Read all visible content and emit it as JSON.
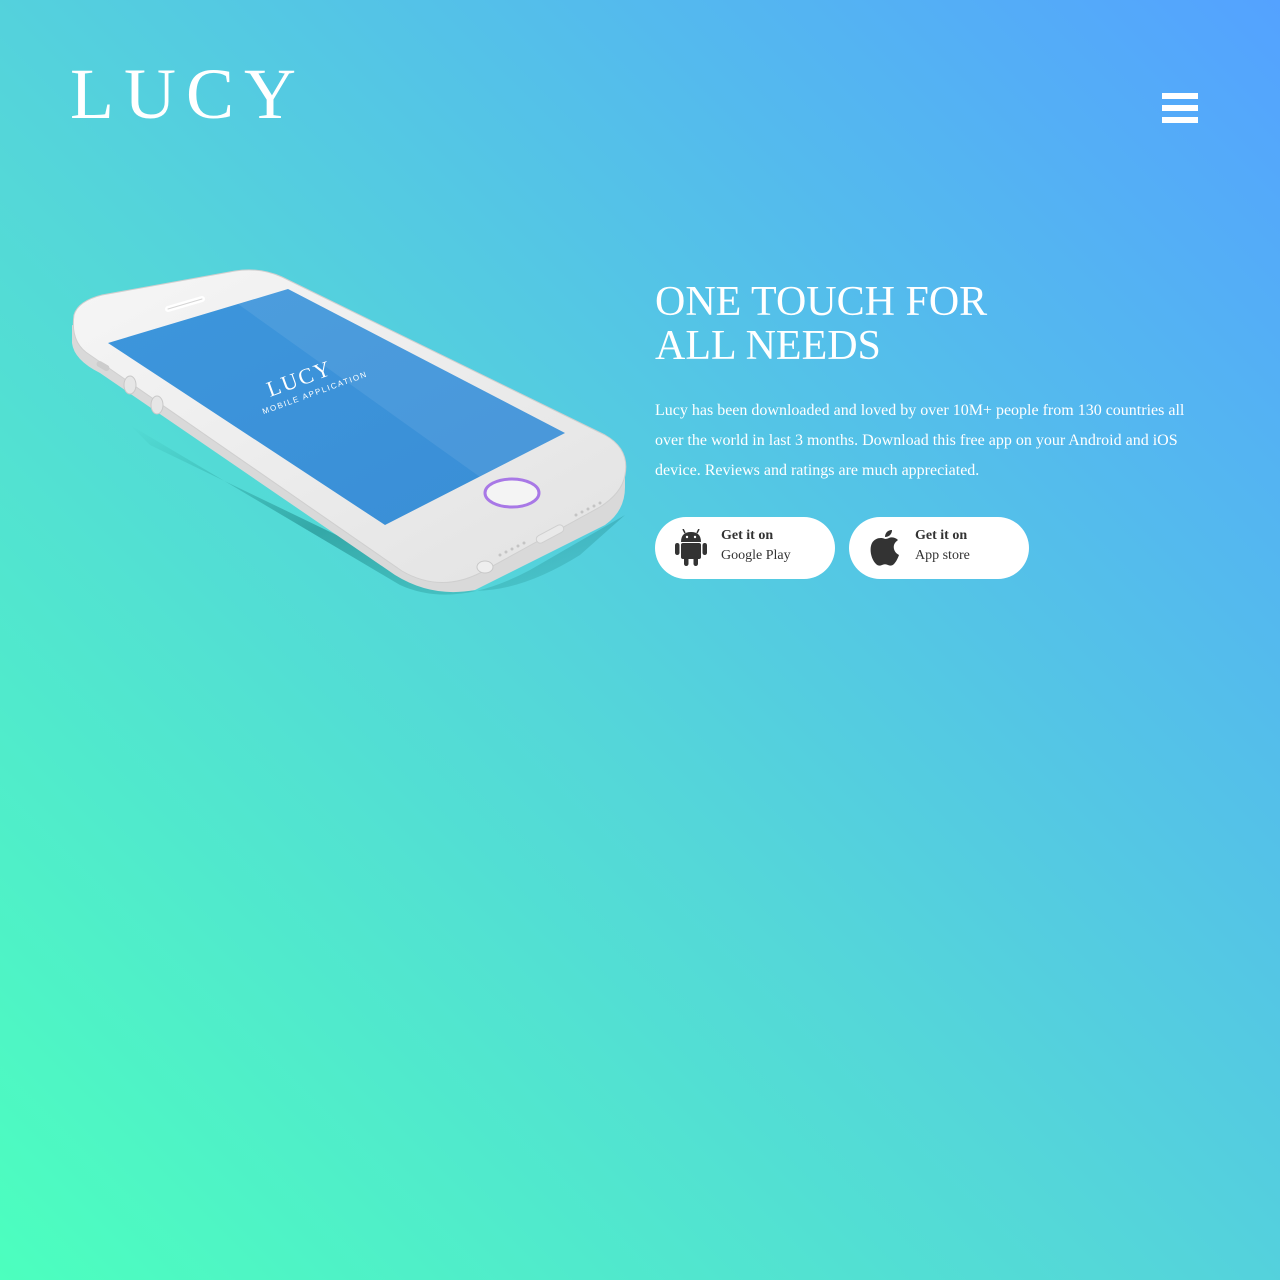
{
  "header": {
    "logo_text": "LUCY",
    "menu_icon": "hamburger-menu-icon"
  },
  "hero": {
    "phone_screen": {
      "app_name": "LUCY",
      "tagline": "MOBILE APPLICATION"
    },
    "headline_line1": "ONE TOUCH FOR",
    "headline_line2": "ALL NEEDS",
    "description": "Lucy has been downloaded and loved by over 10M+ people from 130 countries all over the world in last 3 months. Download this free app on your Android and iOS device. Reviews and ratings are much appreciated.",
    "buttons": [
      {
        "icon": "android-icon",
        "line1": "Get it on",
        "line2": "Google Play"
      },
      {
        "icon": "apple-icon",
        "line1": "Get it on",
        "line2": "App store"
      }
    ]
  },
  "colors": {
    "gradient_start": "#4cffbe",
    "gradient_mid": "#54d6d9",
    "gradient_end": "#54a2ff",
    "screen_blue": "#3d9bdc",
    "home_ring": "#a878e6",
    "button_text": "#333333"
  }
}
